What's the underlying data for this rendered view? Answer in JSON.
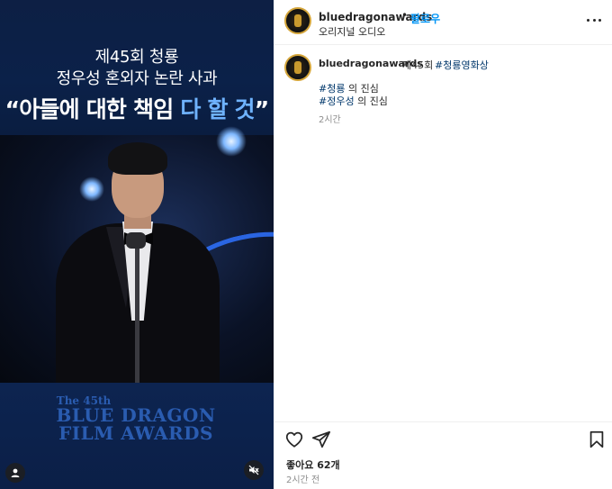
{
  "media": {
    "headline_line1": "제45회 청룡",
    "headline_line2": "정우성 혼외자 논란 사과",
    "quote_main": "“아들에 대한 책임 ",
    "quote_highlight": "다 할 것",
    "quote_end": "”",
    "logo_line1": "The 45th",
    "logo_line2": "BLUE DRAGON",
    "logo_line3": "FILM AWARDS",
    "tag_icon": "user-tag-icon",
    "mute_icon": "speaker-muted-icon"
  },
  "header": {
    "username": "bluedragonawards",
    "dot": "•",
    "follow_label": "팔로우",
    "audio_label": "오리지널 오디오",
    "more_icon": "more-options-icon"
  },
  "caption": {
    "username": "bluedragonawards",
    "text": "제45회",
    "hashtag": "#청룡영화상",
    "line2_tag": "#청룡",
    "line2_text": " 의 진심",
    "line3_tag": "#정우성",
    "line3_text": " 의 진심",
    "time": "2시간"
  },
  "actions": {
    "like_icon": "heart-icon",
    "share_icon": "send-icon",
    "save_icon": "bookmark-icon",
    "likes_label": "좋아요 62개",
    "time_ago": "2시간 전"
  },
  "colors": {
    "accent": "#0095f6",
    "hashtag": "#00376b",
    "highlight": "#6fb3ff"
  }
}
